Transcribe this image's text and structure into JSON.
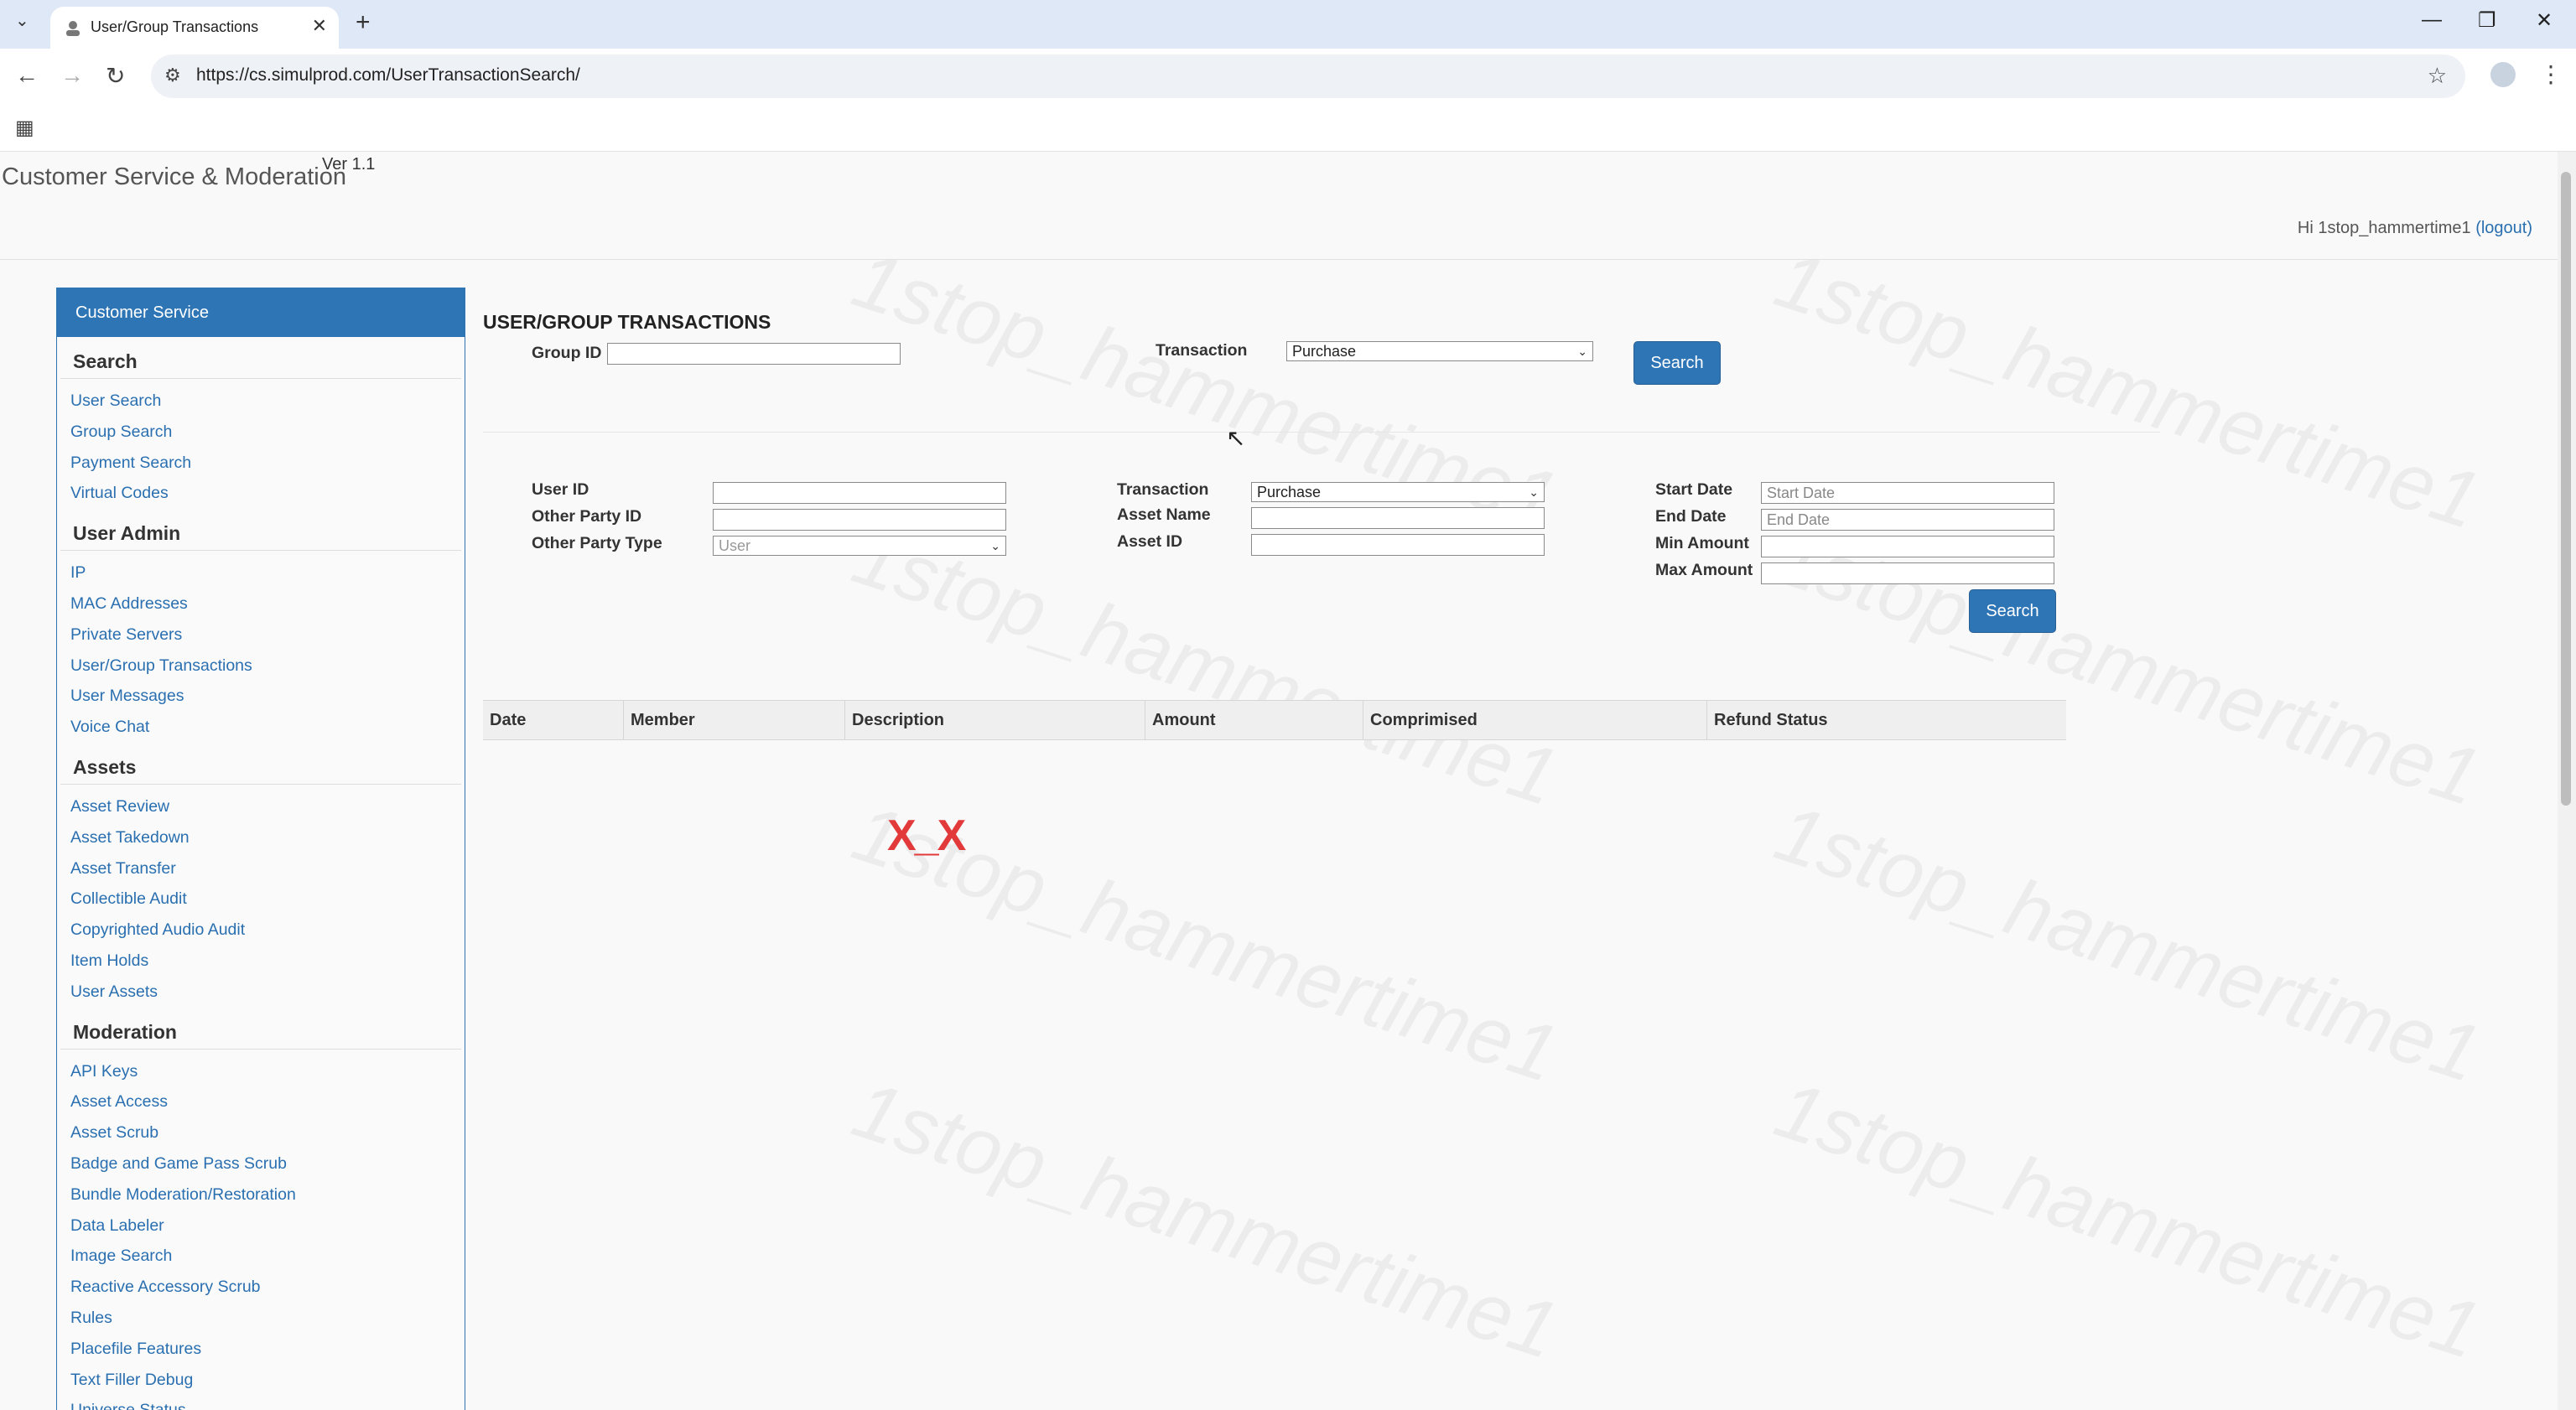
{
  "browser": {
    "tab_title": "User/Group Transactions",
    "url": "https://cs.simulprod.com/UserTransactionSearch/"
  },
  "header": {
    "app_title": "Customer Service & Moderation",
    "version": "Ver 1.1",
    "greeting": "Hi 1stop_hammertime1",
    "logout": "(logout)"
  },
  "watermark": "1stop_hammertime1",
  "sidebar": {
    "header": "Customer Service",
    "sections": [
      {
        "title": "Search",
        "items": [
          "User Search",
          "Group Search",
          "Payment Search",
          "Virtual Codes"
        ]
      },
      {
        "title": "User Admin",
        "items": [
          "IP",
          "MAC Addresses",
          "Private Servers",
          "User/Group Transactions",
          "User Messages",
          "Voice Chat"
        ]
      },
      {
        "title": "Assets",
        "items": [
          "Asset Review",
          "Asset Takedown",
          "Asset Transfer",
          "Collectible Audit",
          "Copyrighted Audio Audit",
          "Item Holds",
          "User Assets"
        ]
      },
      {
        "title": "Moderation",
        "items": [
          "API Keys",
          "Asset Access",
          "Asset Scrub",
          "Badge and Game Pass Scrub",
          "Bundle Moderation/Restoration",
          "Data Labeler",
          "Image Search",
          "Reactive Accessory Scrub",
          "Rules",
          "Placefile Features",
          "Text Filler Debug",
          "Universe Status"
        ]
      }
    ]
  },
  "main": {
    "heading": "USER/GROUP TRANSACTIONS",
    "group_form": {
      "group_id_label": "Group ID",
      "group_id_value": "",
      "transaction_label": "Transaction",
      "transaction_value": "Purchase",
      "search": "Search"
    },
    "user_form": {
      "user_id_label": "User ID",
      "other_party_id_label": "Other Party ID",
      "other_party_type_label": "Other Party Type",
      "other_party_type_value": "User",
      "transaction_label": "Transaction",
      "transaction_value": "Purchase",
      "asset_name_label": "Asset Name",
      "asset_id_label": "Asset ID",
      "start_date_label": "Start Date",
      "start_date_placeholder": "Start Date",
      "end_date_label": "End Date",
      "end_date_placeholder": "End Date",
      "min_amount_label": "Min Amount",
      "max_amount_label": "Max Amount",
      "search": "Search"
    },
    "table": {
      "columns": [
        "Date",
        "Member",
        "Description",
        "Amount",
        "Comprimised",
        "Refund Status"
      ],
      "empty_face": "X_X"
    }
  }
}
